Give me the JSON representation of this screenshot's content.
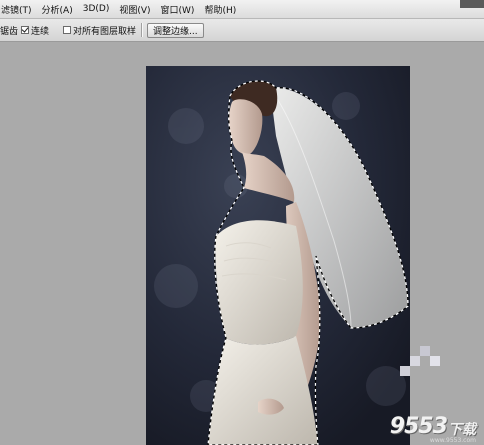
{
  "menu": {
    "items": [
      "滤镜(T)",
      "分析(A)",
      "3D(D)",
      "视图(V)",
      "窗口(W)",
      "帮助(H)"
    ]
  },
  "options": {
    "partial_label": "锯齿",
    "contiguous_label": "连续",
    "contiguous_checked": true,
    "sample_all_label": "对所有图层取样",
    "sample_all_checked": false,
    "refine_button": "调整边缘..."
  },
  "watermark": {
    "number": "9553",
    "text": "下载",
    "url": "www.9553.com"
  }
}
